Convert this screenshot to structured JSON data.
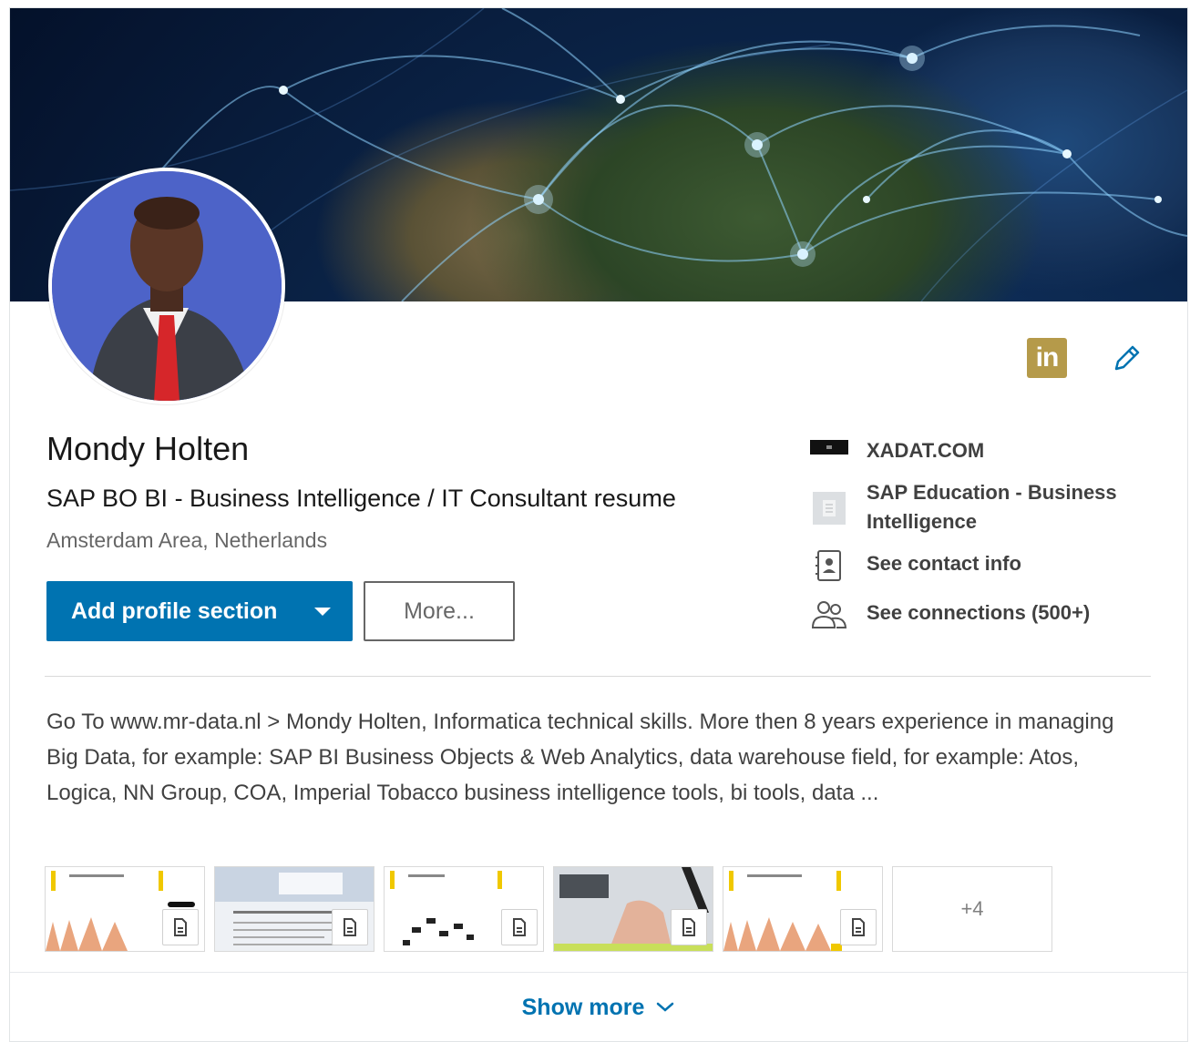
{
  "profile": {
    "name": "Mondy Holten",
    "headline": "SAP BO BI - Business Intelligence / IT Consultant resume",
    "location": "Amsterdam Area, Netherlands"
  },
  "icons": {
    "linkedin_badge": "in",
    "edit": "pencil-icon"
  },
  "actions": {
    "add_section_label": "Add profile section",
    "more_label": "More..."
  },
  "side": {
    "company": "XADAT.COM",
    "education": "SAP Education - Business Intelligence",
    "contact": "See contact info",
    "connections": "See connections (500+)"
  },
  "summary": "Go To www.mr-data.nl > Mondy Holten, Informatica technical skills. More then 8 years experience in managing Big Data, for example: SAP BI Business Objects & Web Analytics, data warehouse field, for example: Atos, Logica, NN Group, COA, Imperial Tobacco business intelligence tools, bi tools, data ...",
  "media": {
    "more_count": "+4"
  },
  "footer": {
    "show_more": "Show more"
  },
  "colors": {
    "primary": "#0073b1",
    "linkedin_gold": "#b59a4a"
  }
}
